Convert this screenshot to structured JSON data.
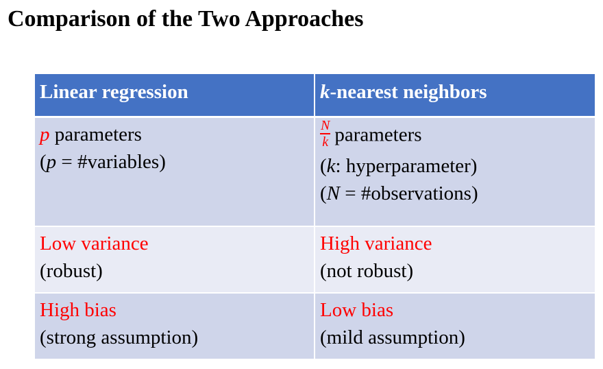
{
  "title": "Comparison of the Two Approaches",
  "table": {
    "headers": {
      "left": "Linear regression",
      "right_var": "k",
      "right_text": "-nearest neighbors"
    },
    "params": {
      "left_var": "p",
      "left_text": " parameters",
      "left_sub_open": "(",
      "left_sub_var": "p",
      "left_sub_text": " = #variables)",
      "right_frac_num": "N",
      "right_frac_den": "k",
      "right_text": "parameters",
      "right_sub1_open": "(",
      "right_sub1_var": "k",
      "right_sub1_text": ": hyperparameter)",
      "right_sub2_open": "(",
      "right_sub2_var": "N",
      "right_sub2_text": " = #observations)"
    },
    "variance": {
      "left_main": "Low variance",
      "left_sub": "(robust)",
      "right_main": "High variance",
      "right_sub": "(not robust)"
    },
    "bias": {
      "left_main": "High bias",
      "left_sub": "(strong assumption)",
      "right_main": "Low bias",
      "right_sub": "(mild assumption)"
    }
  },
  "colors": {
    "header_bg": "#4472c4",
    "row_dark": "#cfd5ea",
    "row_light": "#e9ebf5",
    "highlight": "#ff0000"
  }
}
